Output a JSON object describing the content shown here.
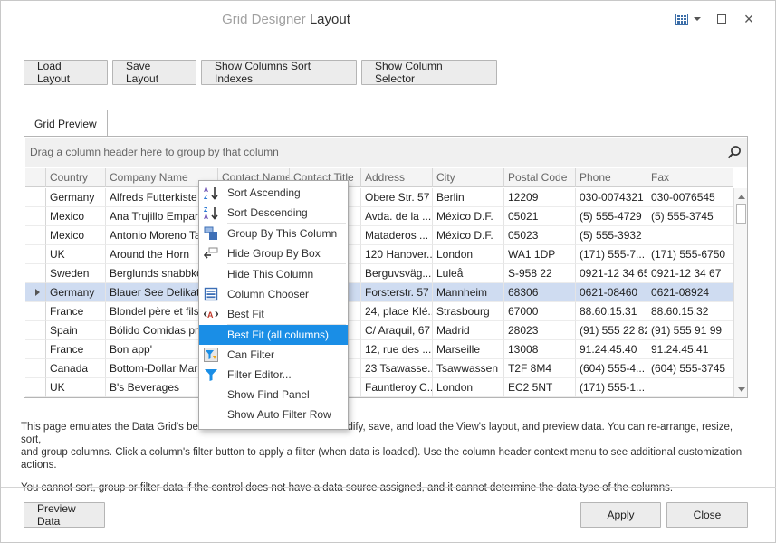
{
  "window": {
    "title_prefix": "Grid Designer",
    "title_main": "Layout",
    "close_glyph": "×"
  },
  "toolbar": {
    "load_layout": "Load Layout",
    "save_layout": "Save Layout",
    "show_sort_indexes": "Show Columns Sort Indexes",
    "show_column_selector": "Show Column Selector"
  },
  "tab": {
    "label": "Grid Preview"
  },
  "grid": {
    "group_panel_text": "Drag a column header here to group by that column",
    "columns": [
      "Country",
      "Company Name",
      "Contact Name",
      "Contact Title",
      "Address",
      "City",
      "Postal Code",
      "Phone",
      "Fax"
    ],
    "rows": [
      [
        "Germany",
        "Alfreds Futterkiste",
        "",
        "",
        "Obere Str. 57",
        "Berlin",
        "12209",
        "030-0074321",
        "030-0076545"
      ],
      [
        "Mexico",
        "Ana Trujillo Emparedados",
        "",
        "",
        "Avda. de la ...",
        "México D.F.",
        "05021",
        "(5) 555-4729",
        "(5) 555-3745"
      ],
      [
        "Mexico",
        "Antonio Moreno Taquería",
        "",
        "",
        "Mataderos ...",
        "México D.F.",
        "05023",
        "(5) 555-3932",
        ""
      ],
      [
        "UK",
        "Around the Horn",
        "",
        "",
        "120 Hanover...",
        "London",
        "WA1 1DP",
        "(171) 555-7...",
        "(171) 555-6750"
      ],
      [
        "Sweden",
        "Berglunds snabbköp",
        "",
        "",
        "Berguvsväg...",
        "Luleå",
        "S-958 22",
        "0921-12 34 65",
        "0921-12 34 67"
      ],
      [
        "Germany",
        "Blauer See Delikatessen",
        "",
        "",
        "Forsterstr. 57",
        "Mannheim",
        "68306",
        "0621-08460",
        "0621-08924"
      ],
      [
        "France",
        "Blondel père et fils",
        "",
        "",
        "24, place Klé...",
        "Strasbourg",
        "67000",
        "88.60.15.31",
        "88.60.15.32"
      ],
      [
        "Spain",
        "Bólido Comidas preparadas",
        "",
        "",
        "C/ Araquil, 67",
        "Madrid",
        "28023",
        "(91) 555 22 82",
        "(91) 555 91 99"
      ],
      [
        "France",
        "Bon app'",
        "",
        "",
        "12, rue des ...",
        "Marseille",
        "13008",
        "91.24.45.40",
        "91.24.45.41"
      ],
      [
        "Canada",
        "Bottom-Dollar Markets",
        "",
        "",
        "23 Tsawasse...",
        "Tsawwassen",
        "T2F 8M4",
        "(604) 555-4...",
        "(604) 555-3745"
      ],
      [
        "UK",
        "B's Beverages",
        "",
        "",
        "Fauntleroy C...",
        "London",
        "EC2 5NT",
        "(171) 555-1...",
        ""
      ]
    ],
    "selected_row": 5
  },
  "context_menu": {
    "items": [
      {
        "label": "Sort Ascending",
        "icon": "sort-ascending-icon"
      },
      {
        "label": "Sort Descending",
        "icon": "sort-descending-icon"
      },
      {
        "label": "Group By This Column",
        "icon": "group-by-column-icon"
      },
      {
        "label": "Hide Group By Box",
        "icon": "hide-group-box-icon"
      },
      {
        "label": "Hide This Column",
        "icon": ""
      },
      {
        "label": "Column Chooser",
        "icon": "column-chooser-icon"
      },
      {
        "label": "Best Fit",
        "icon": "best-fit-icon"
      },
      {
        "label": "Best Fit (all columns)",
        "icon": ""
      },
      {
        "label": "Can Filter",
        "icon": "can-filter-icon"
      },
      {
        "label": "Filter Editor...",
        "icon": "filter-editor-icon"
      },
      {
        "label": "Show Find Panel",
        "icon": ""
      },
      {
        "label": "Show Auto Filter Row",
        "icon": ""
      }
    ],
    "highlighted_index": 7,
    "highlight_color": "#1a8ee6"
  },
  "description": {
    "p1_line1_left": "This page emulates the Data Grid's behav",
    "p1_line1_right": "dify, save, and load the View's layout, and preview data. You can re-arrange, resize, sort,",
    "p1_line2": "and group columns. Click a column's filter button to apply a filter (when data is loaded). Use the column header context menu to see additional customization actions.",
    "p2": "You cannot sort, group or filter data if the control does not have a data source assigned, and it cannot determine the data type of the columns."
  },
  "footer": {
    "preview_data": "Preview Data",
    "apply": "Apply",
    "close": "Close"
  },
  "colors": {
    "selected_row": "#cfdcf1",
    "button_bg": "#ececec"
  }
}
